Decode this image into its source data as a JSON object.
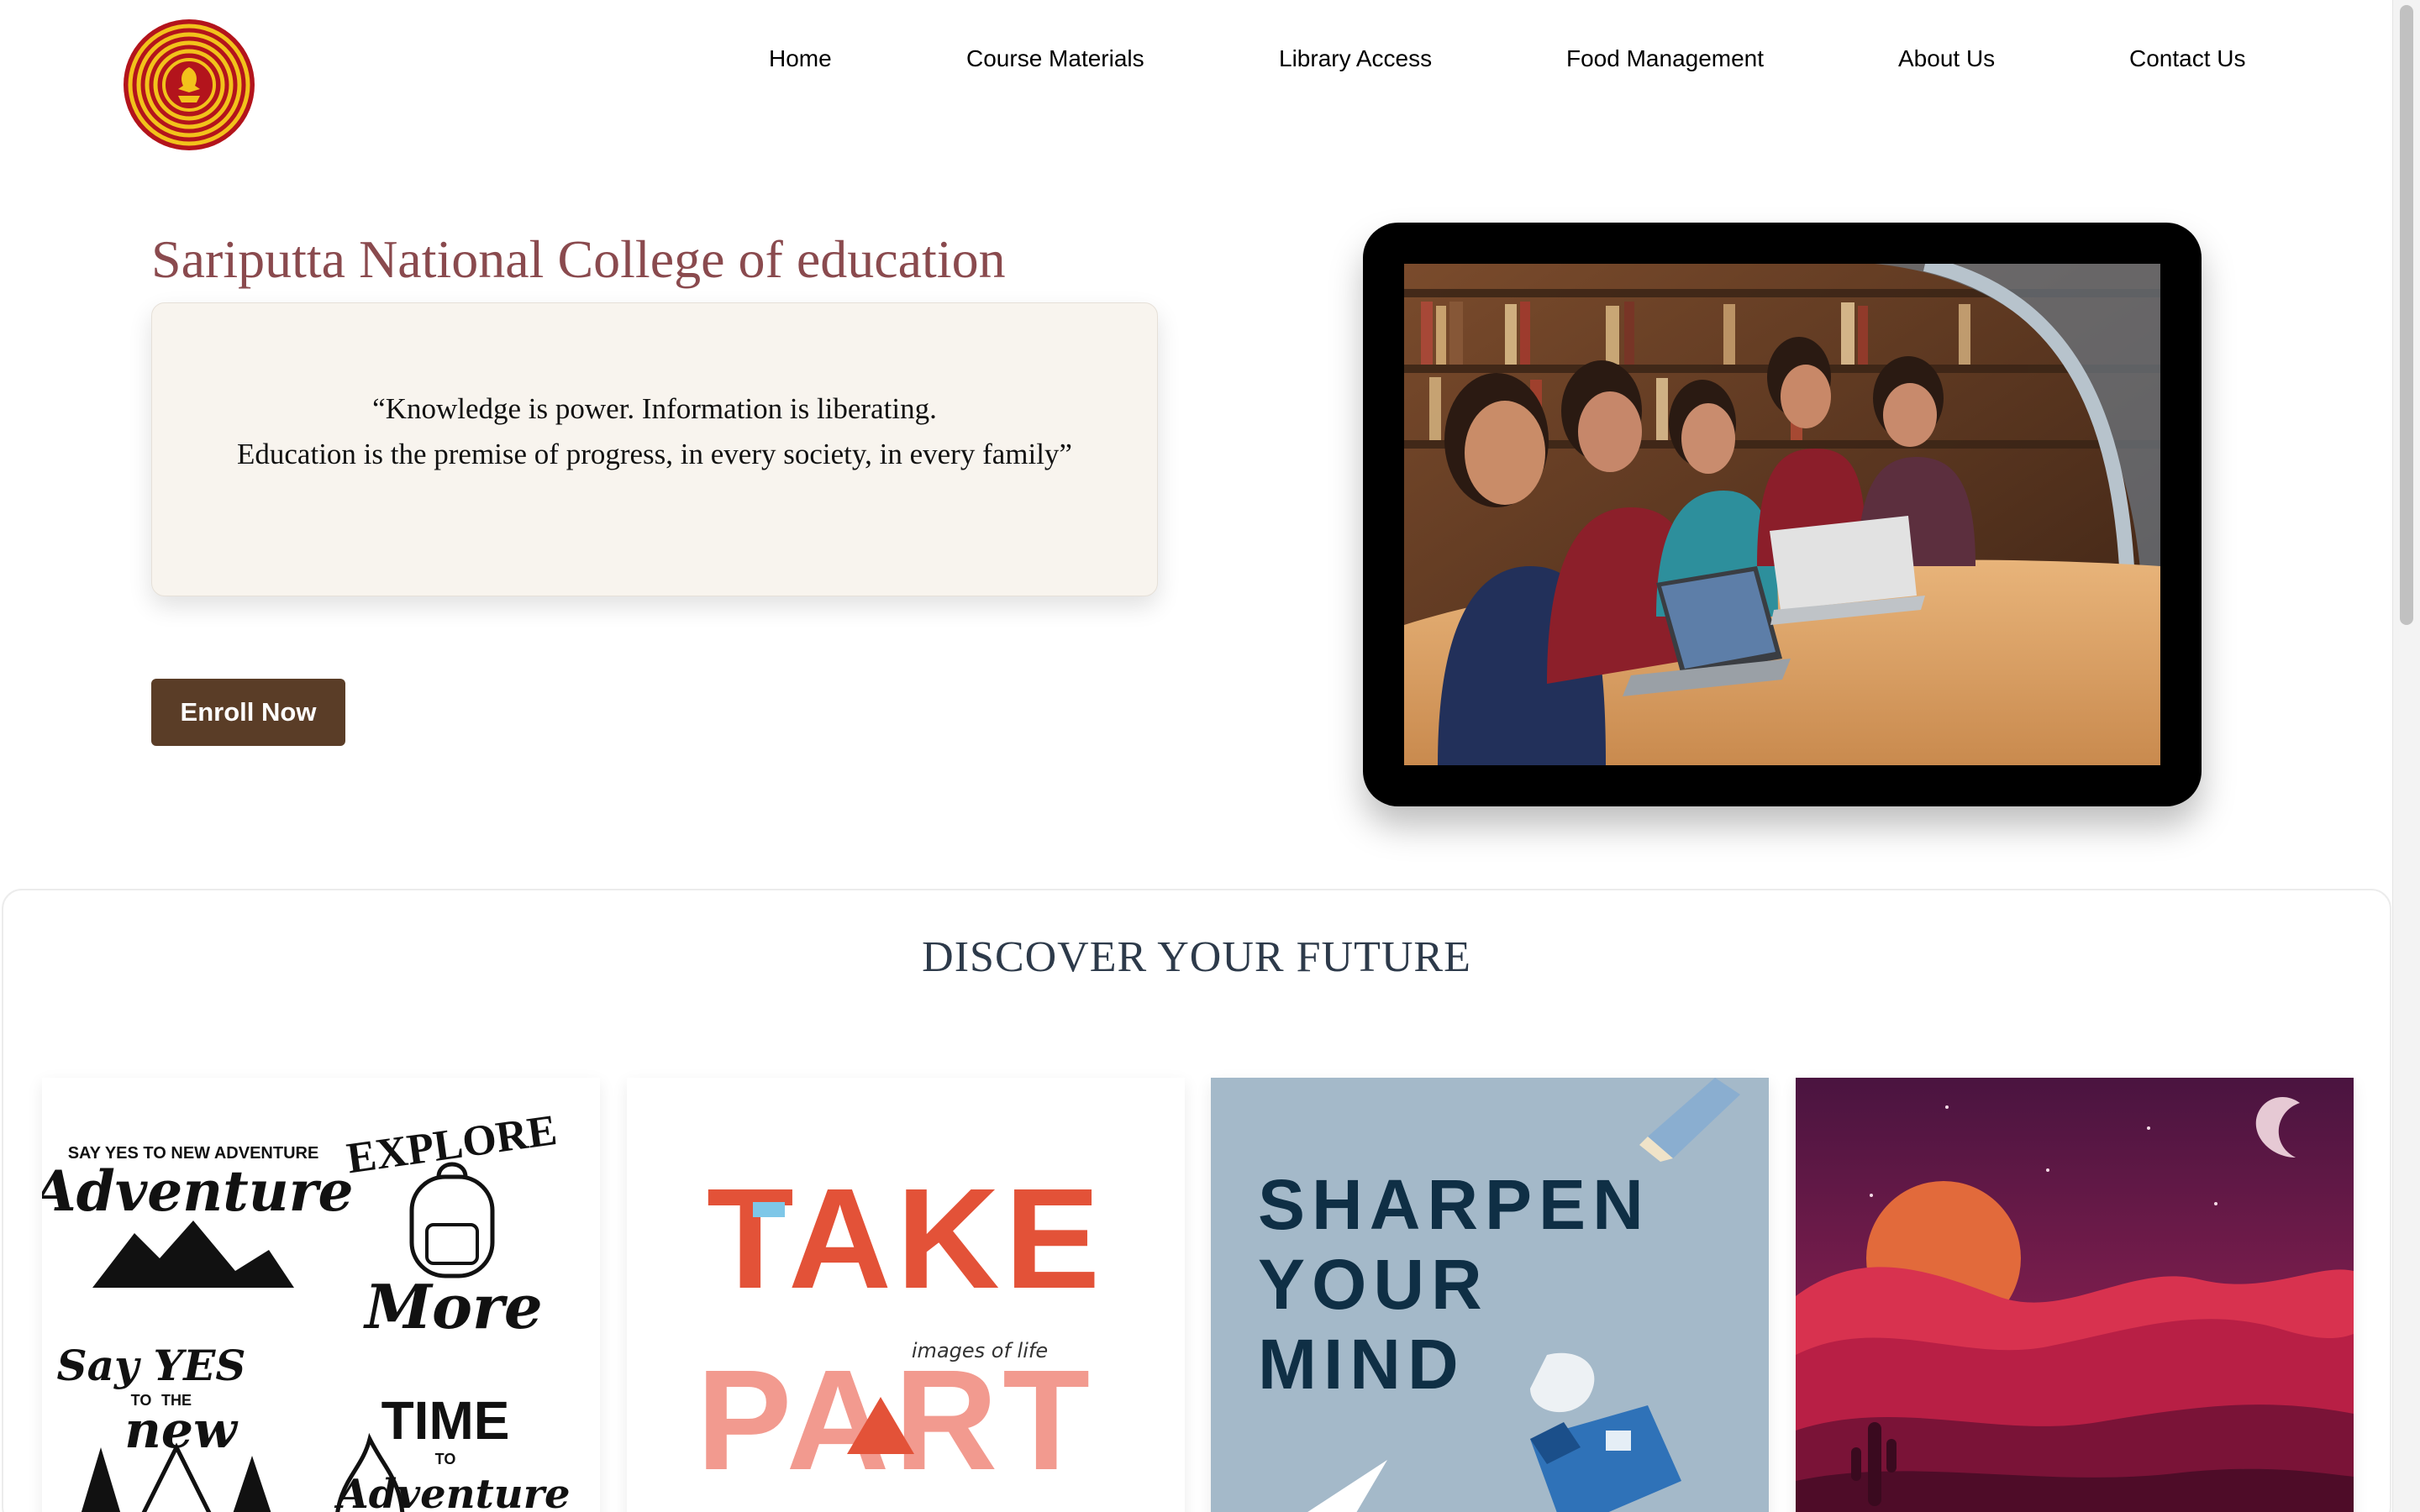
{
  "nav": {
    "items": [
      "Home",
      "Course Materials",
      "Library Access",
      "Food Management",
      "About Us",
      "Contact Us"
    ]
  },
  "hero": {
    "title": "Sariputta National College of education",
    "quote_line_1": "“Knowledge is power. Information is liberating.",
    "quote_line_2": "Education is the premise of progress, in every society, in every family”",
    "enroll_label": "Enroll Now"
  },
  "discover": {
    "title": "DISCOVER YOUR FUTURE",
    "cards": [
      {
        "lines": [
          "SAY YES TO NEW ADVENTURE",
          "Adventure",
          "EXPLORE",
          "More",
          "Say YES",
          "TO",
          "THE",
          "new",
          "TIME",
          "TO",
          "Adventure"
        ]
      },
      {
        "lines": [
          "TAKE",
          "PART",
          "images of life"
        ]
      },
      {
        "lines": [
          "SHARPEN",
          "YOUR",
          "MIND"
        ]
      },
      {
        "lines": []
      }
    ]
  },
  "colors": {
    "title": "#8a4a4e",
    "button": "#5a3d27",
    "quote_bg": "#f8f4ee",
    "card3_bg": "#a4b9c9",
    "card3_text": "#0f2f45"
  }
}
